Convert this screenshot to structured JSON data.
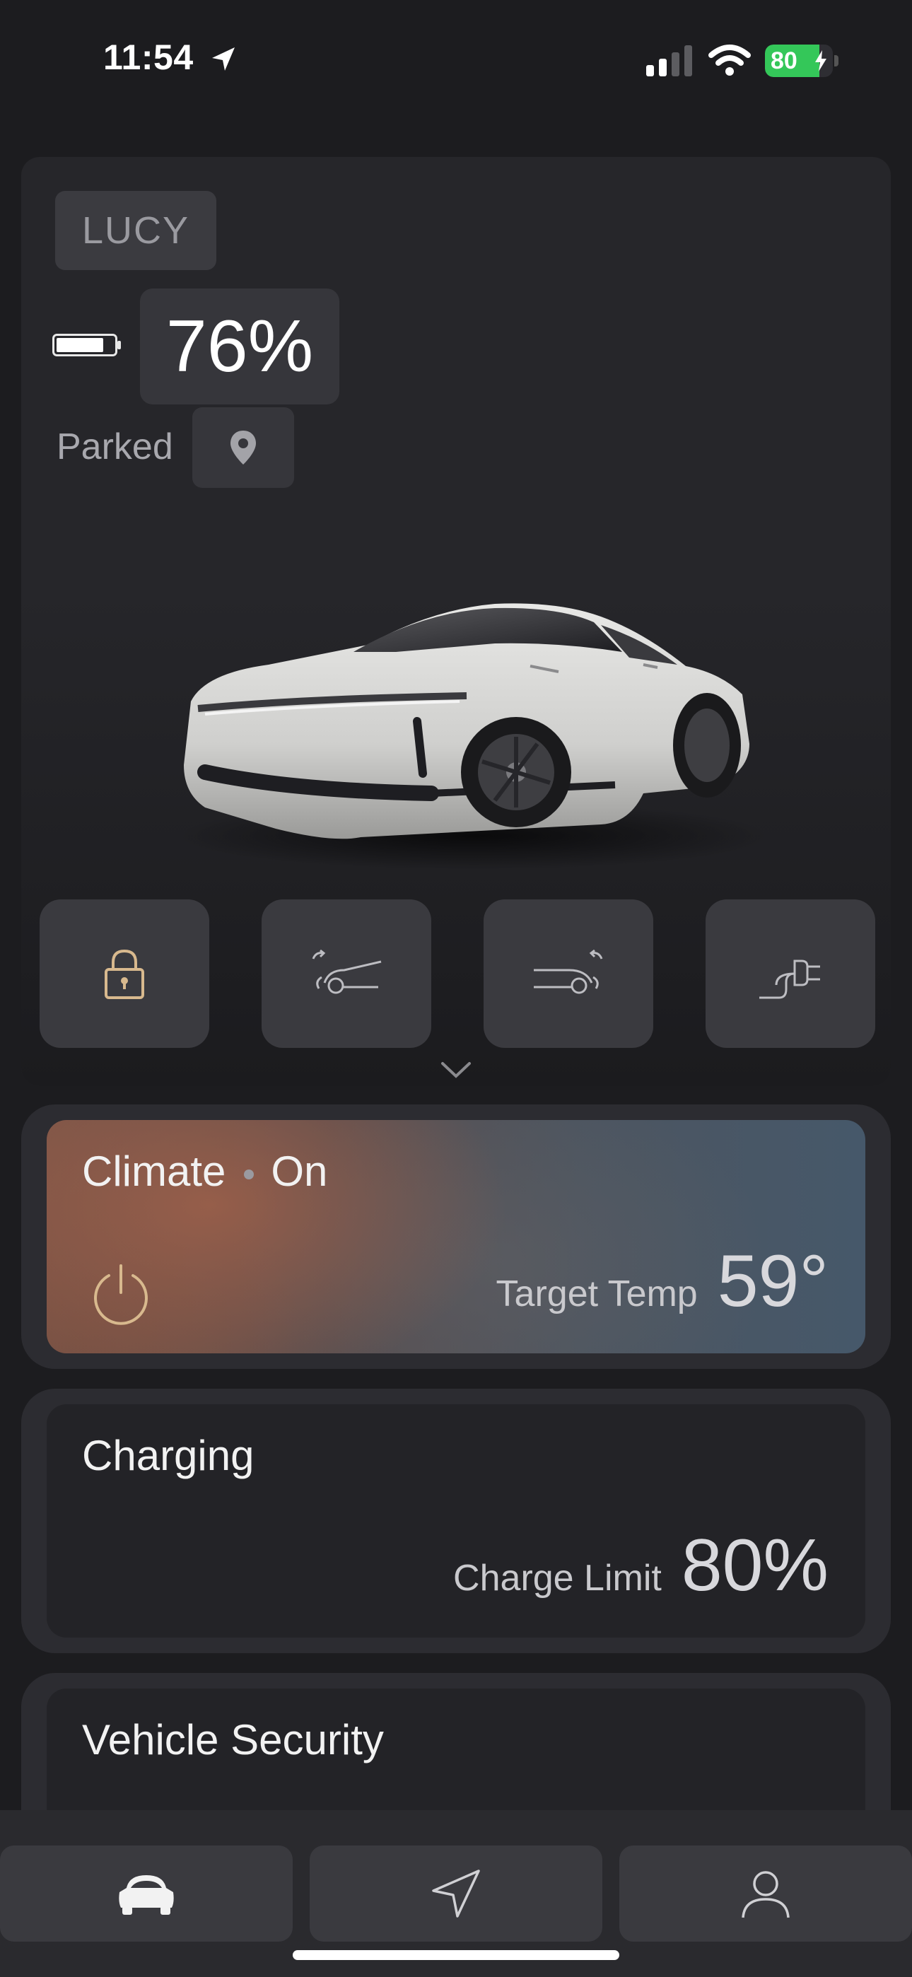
{
  "status_bar": {
    "time": "11:54",
    "battery_level": "80",
    "battery_fraction": 0.8,
    "battery_color": "#34c759"
  },
  "vehicle": {
    "name": "LUCY",
    "battery_percent": "76%",
    "state": "Parked",
    "quick_actions": [
      {
        "icon": "lock-icon"
      },
      {
        "icon": "frunk-icon"
      },
      {
        "icon": "trunk-icon"
      },
      {
        "icon": "charge-port-icon"
      }
    ]
  },
  "cards": {
    "climate": {
      "title": "Climate",
      "status": "On",
      "target_label": "Target Temp",
      "target_value": "59°"
    },
    "charging": {
      "title": "Charging",
      "limit_label": "Charge Limit",
      "limit_value": "80%"
    },
    "security": {
      "title": "Vehicle Security"
    }
  },
  "tabs": [
    {
      "icon": "car-icon",
      "active": true
    },
    {
      "icon": "navigation-icon",
      "active": false
    },
    {
      "icon": "profile-icon",
      "active": false
    }
  ]
}
